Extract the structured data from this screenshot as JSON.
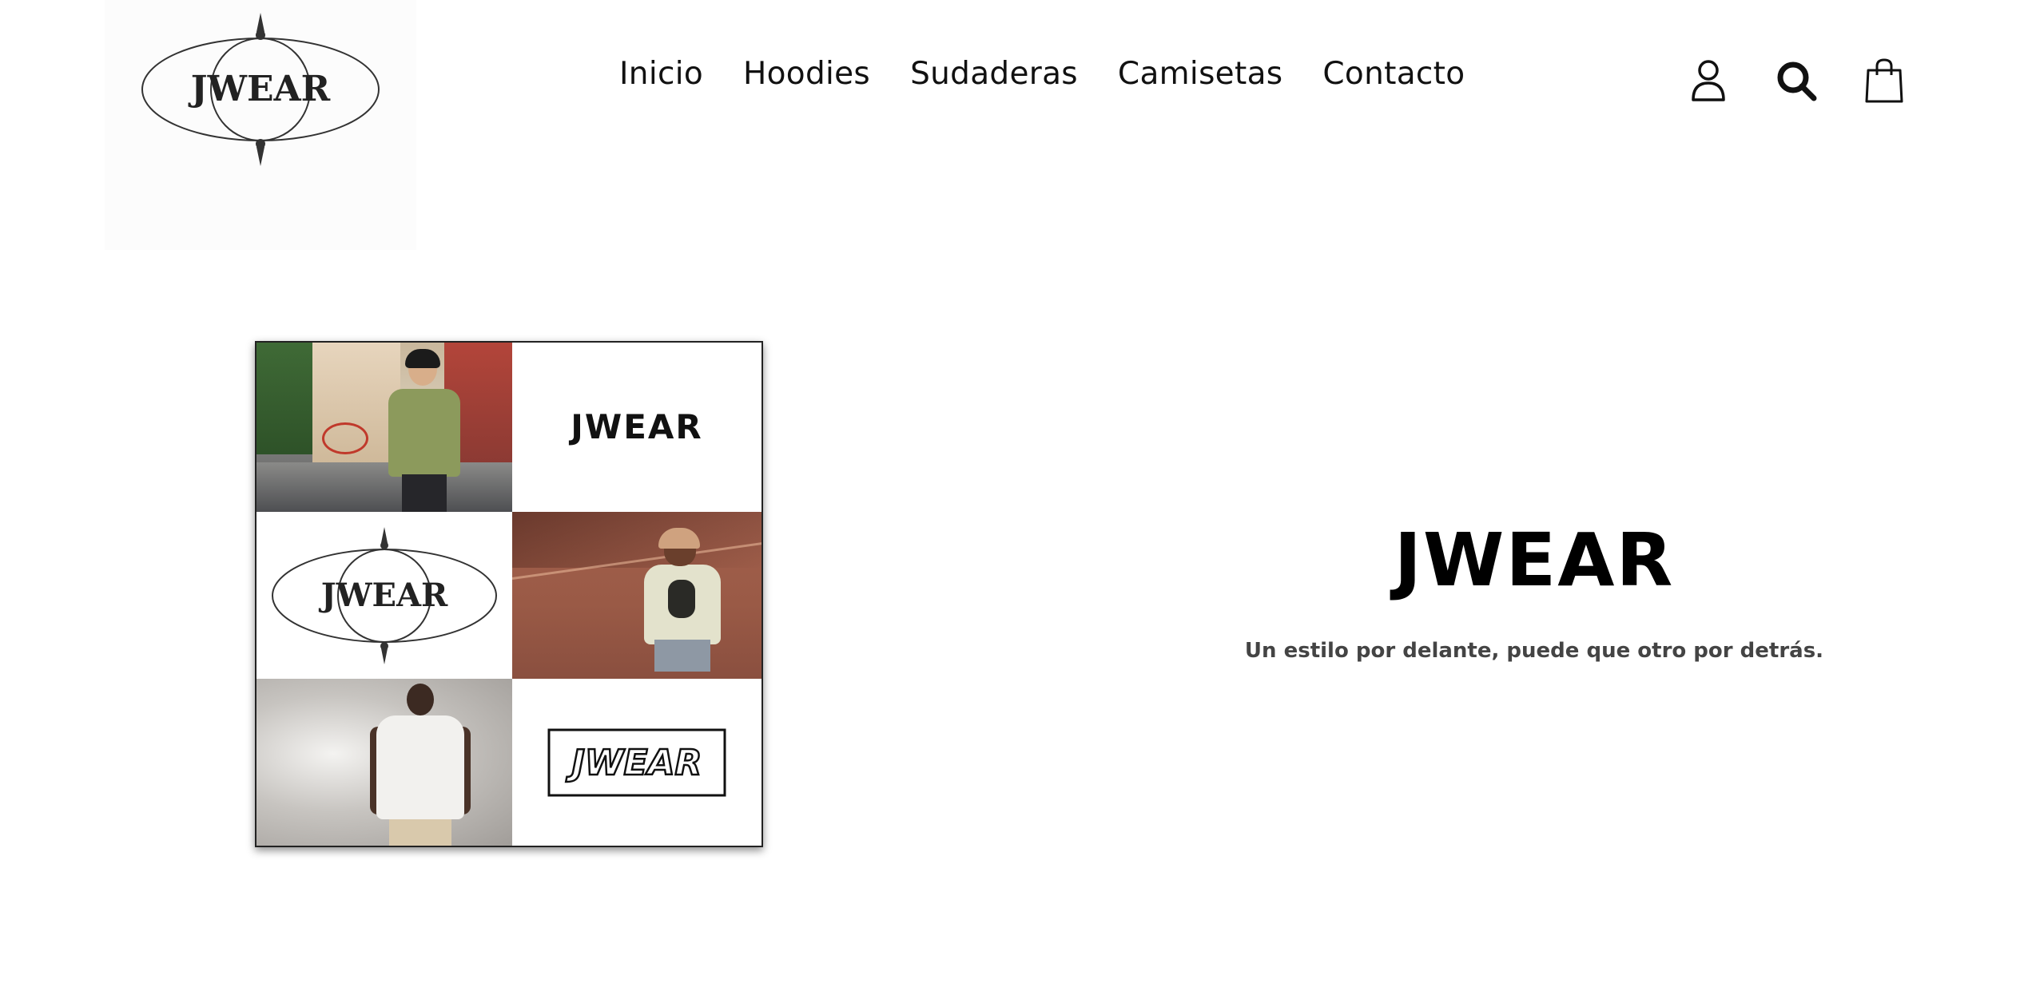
{
  "brand": {
    "logo_text": "JWEAR",
    "accent_color": "#111111"
  },
  "nav": {
    "items": [
      {
        "label": "Inicio"
      },
      {
        "label": "Hoodies"
      },
      {
        "label": "Sudaderas"
      },
      {
        "label": "Camisetas"
      },
      {
        "label": "Contacto"
      }
    ]
  },
  "header_icons": [
    {
      "name": "user-icon"
    },
    {
      "name": "search-icon"
    },
    {
      "name": "shopping-bag-icon"
    }
  ],
  "collage": {
    "tiles": [
      {
        "type": "photo",
        "subject": "man in green t-shirt on street"
      },
      {
        "type": "logo",
        "text": "JWEAR"
      },
      {
        "type": "logo",
        "text": "JWEAR"
      },
      {
        "type": "photo",
        "subject": "person in cream sweatshirt against wall"
      },
      {
        "type": "photo",
        "subject": "man in white t-shirt"
      },
      {
        "type": "logo",
        "text": "JWEAR"
      }
    ]
  },
  "hero": {
    "title": "JWEAR",
    "subtitle": "Un estilo por delante, puede que otro por detrás."
  }
}
